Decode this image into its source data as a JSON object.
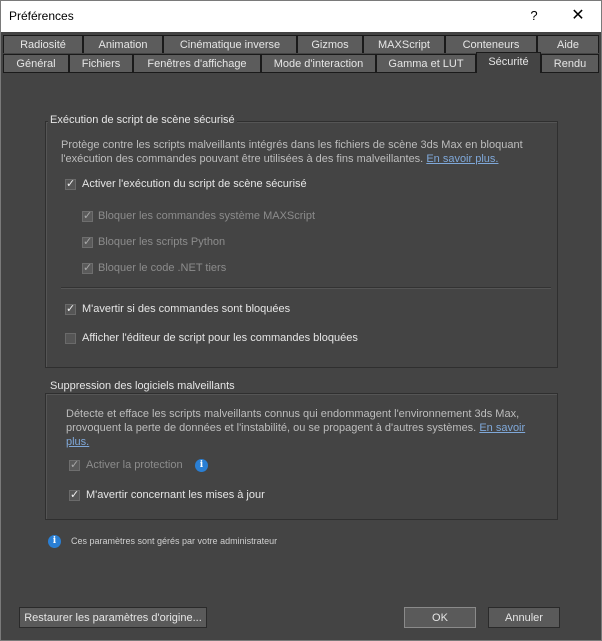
{
  "window": {
    "title": "Préférences",
    "help_label": "?",
    "close_label": "✕"
  },
  "tabs_row1": [
    "Radiosité",
    "Animation",
    "Cinématique inverse",
    "Gizmos",
    "MAXScript",
    "Conteneurs",
    "Aide"
  ],
  "tabs_row2": [
    "Général",
    "Fichiers",
    "Fenêtres d'affichage",
    "Mode d'interaction",
    "Gamma et LUT",
    "Sécurité",
    "Rendu"
  ],
  "active_tab": "Sécurité",
  "script_group": {
    "title": "Exécution de script de scène sécurisé",
    "desc_line1": "Protège contre les scripts malveillants intégrés dans les fichiers de scène 3ds Max en bloquant",
    "desc_line2": "l'exécution des commandes pouvant être utilisées à des fins malveillantes.",
    "link": "En savoir plus.",
    "enable_label": "Activer l'exécution du script de scène sécurisé",
    "block_maxscript": "Bloquer les commandes système MAXScript",
    "block_python": "Bloquer les scripts Python",
    "block_net": "Bloquer le code .NET tiers",
    "warn_blocked": "M'avertir si des commandes sont bloquées",
    "show_editor": "Afficher l'éditeur de script pour les commandes bloquées"
  },
  "malware_group": {
    "title": "Suppression des logiciels malveillants",
    "desc_line1": "Détecte et efface les scripts malveillants connus qui endommagent l'environnement 3ds Max,",
    "desc_line2": "provoquent la perte de données et l'instabilité, ou se propagent à d'autres systèmes.",
    "link_part1": "En savoir",
    "link_part2": "plus.",
    "enable_protection": "Activer la protection",
    "warn_updates": "M'avertir concernant les mises à jour"
  },
  "admin_note": "Ces paramètres sont gérés par votre administrateur",
  "buttons": {
    "restore": "Restaurer les paramètres d'origine...",
    "ok": "OK",
    "cancel": "Annuler"
  },
  "icons": {
    "info": "info-icon"
  },
  "colors": {
    "accent": "#2a7fd4",
    "link": "#7fa8d9",
    "background": "#444444"
  }
}
